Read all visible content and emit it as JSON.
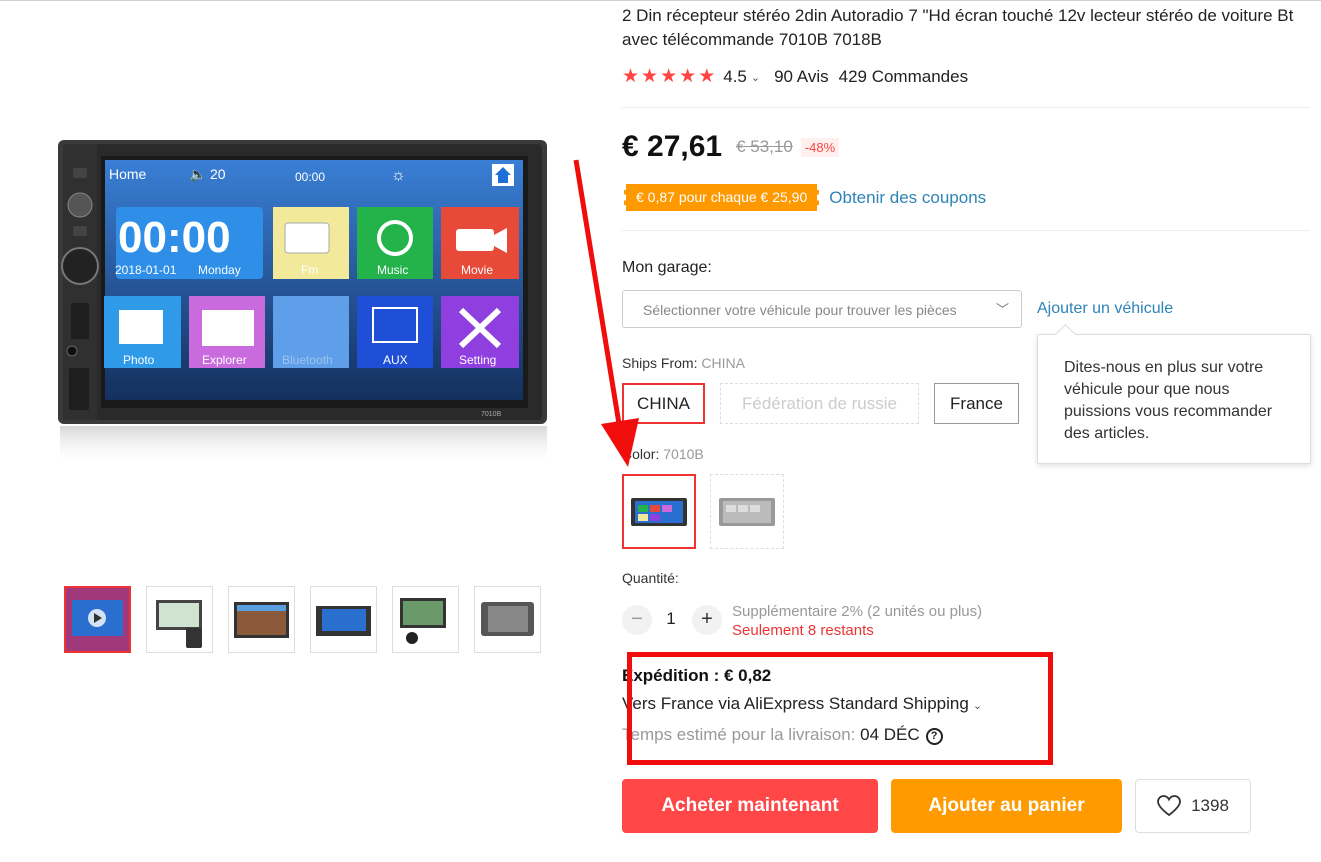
{
  "product": {
    "title": "2 Din récepteur stéréo 2din Autoradio 7 \"Hd écran touché 12v lecteur stéréo de voiture Bt avec télécommande 7010B 7018B",
    "rating": "4.5",
    "reviews": "90 Avis",
    "orders": "429 Commandes"
  },
  "price": {
    "current": "€ 27,61",
    "original": "€ 53,10",
    "discount": "-48%"
  },
  "coupon": {
    "badge": "€ 0,87 pour chaque € 25,90",
    "link": "Obtenir des coupons"
  },
  "garage": {
    "label": "Mon garage:",
    "placeholder": "Sélectionner votre véhicule pour trouver les pièces",
    "add_link": "Ajouter un véhicule",
    "tooltip": "Dites-nous en plus sur votre véhicule pour que nous puissions vous recommander des articles."
  },
  "ships_from": {
    "label": "Ships From:",
    "selected": "CHINA",
    "options": [
      "CHINA",
      "Fédération de russie",
      "France"
    ]
  },
  "color": {
    "label": "Color:",
    "selected": "7010B"
  },
  "quantity": {
    "label": "Quantité:",
    "value": "1",
    "minus": "−",
    "plus": "+",
    "discount_note": "Supplémentaire 2% (2 unités ou plus)",
    "stock_note": "Seulement 8 restants"
  },
  "shipping": {
    "cost": "Expédition : € 0,82",
    "method": "Vers France via AliExpress Standard Shipping",
    "eta_label": "Temps estimé pour la livraison:",
    "eta_date": "04 DÉC"
  },
  "actions": {
    "buy": "Acheter maintenant",
    "cart": "Ajouter au panier",
    "wishlist_count": "1398"
  },
  "device": {
    "top_bar": {
      "home": "Home",
      "volume": "20",
      "time": "00:00"
    },
    "clock": "00:00",
    "date": "2018-01-01",
    "day": "Monday",
    "tiles": [
      "Fm",
      "Music",
      "Movie",
      "Photo",
      "Explorer",
      "Bluetooth",
      "AUX",
      "Setting"
    ],
    "model": "7010B"
  },
  "colors": {
    "accent_red": "#ff4747",
    "accent_orange": "#ff9a00",
    "link_blue": "#2e84b7",
    "annotation_red": "#f20d0d"
  }
}
